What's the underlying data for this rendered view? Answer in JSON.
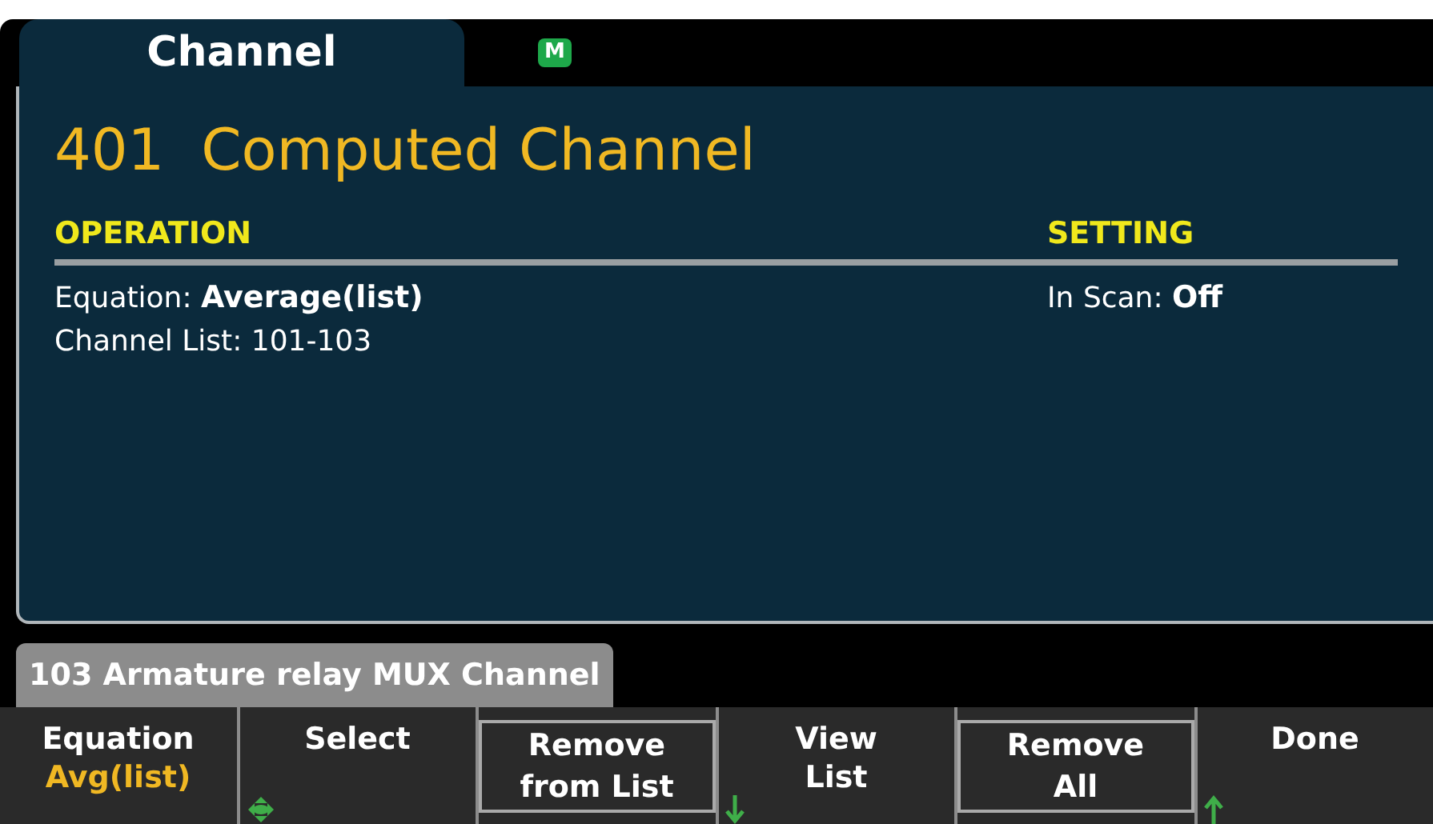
{
  "tabs": [
    {
      "label": "Channel",
      "selected": true
    }
  ],
  "mode_badge": "M",
  "title": "401  Computed Channel",
  "columns": [
    {
      "heading": "OPERATION",
      "lines": [
        {
          "label": "Equation: ",
          "value": "Average(list)"
        },
        {
          "label": "Channel List: 101-103"
        }
      ]
    },
    {
      "heading": "SETTING",
      "lines": [
        {
          "label": "In Scan: ",
          "value": "Off"
        }
      ]
    }
  ],
  "status_tab": "103 Armature relay MUX Channel",
  "softkeys": [
    {
      "kind": "plain",
      "label": "Equation",
      "value": "Avg(list)"
    },
    {
      "kind": "plain",
      "label": "Select",
      "indicator": {
        "kind": "knob"
      }
    },
    {
      "kind": "boxed",
      "label": "Remove from List"
    },
    {
      "kind": "plain",
      "label": "View List",
      "indicator": {
        "kind": "down"
      }
    },
    {
      "kind": "boxed",
      "label": "Remove All"
    },
    {
      "kind": "plain",
      "label": "Done",
      "indicator": {
        "kind": "up"
      }
    }
  ]
}
